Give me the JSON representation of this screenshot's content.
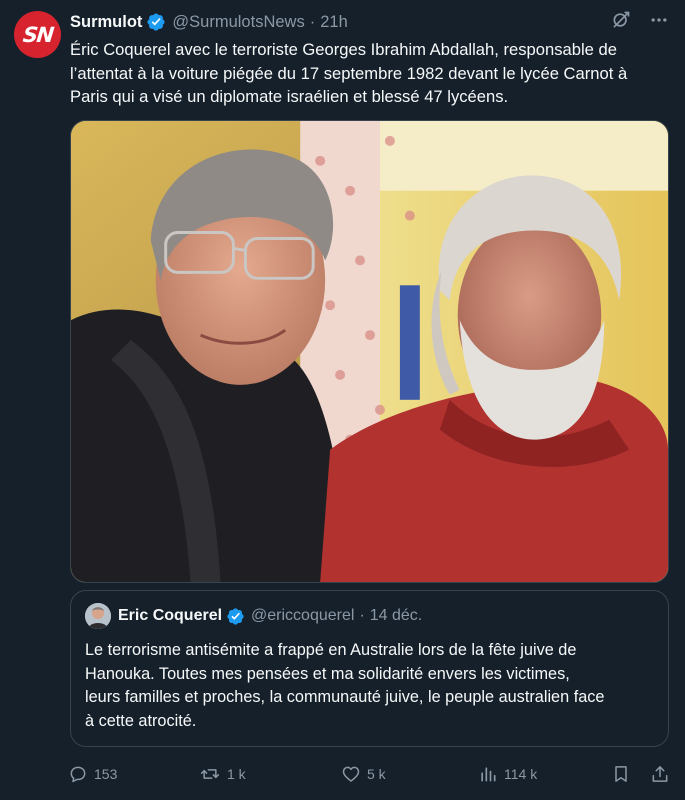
{
  "tweet": {
    "display_name": "Surmulot",
    "handle": "@SurmulotsNews",
    "separator": "·",
    "time": "21h",
    "avatar_initials": "SN",
    "text": "Éric Coquerel avec le terroriste Georges Ibrahim Abdallah, responsable de\nl’attentat à la voiture piégée du 17 septembre 1982 devant le lycée Carnot à\nParis qui a visé un diplomate israélien et  blessé 47 lycéens.",
    "photo": {
      "alt": ""
    }
  },
  "quote": {
    "display_name": "Eric Coquerel",
    "handle": "@ericcoquerel",
    "separator": "·",
    "time": "14 déc.",
    "text": "Le terrorisme antisémite a frappé en Australie lors de la fête juive de\nHanouka. Toutes mes pensées et ma solidarité envers les victimes,\nleurs familles et proches, la communauté juive, le peuple australien face\nà cette atrocité."
  },
  "actions": {
    "replies": "153",
    "reposts": "1 k",
    "likes": "5 k",
    "views": "114 k"
  },
  "icons": {
    "verified": "verified-badge-icon",
    "grok": "grok-icon",
    "more": "more-icon",
    "reply": "reply-icon",
    "repost": "repost-icon",
    "like": "like-icon",
    "views": "views-icon",
    "bookmark": "bookmark-icon",
    "share": "share-icon"
  },
  "colors": {
    "background": "#15202b",
    "text": "#f7f9f9",
    "secondary": "#8b98a5",
    "border": "#38444d",
    "verified": "#1d9bf0",
    "brand_avatar": "#d7232e"
  }
}
